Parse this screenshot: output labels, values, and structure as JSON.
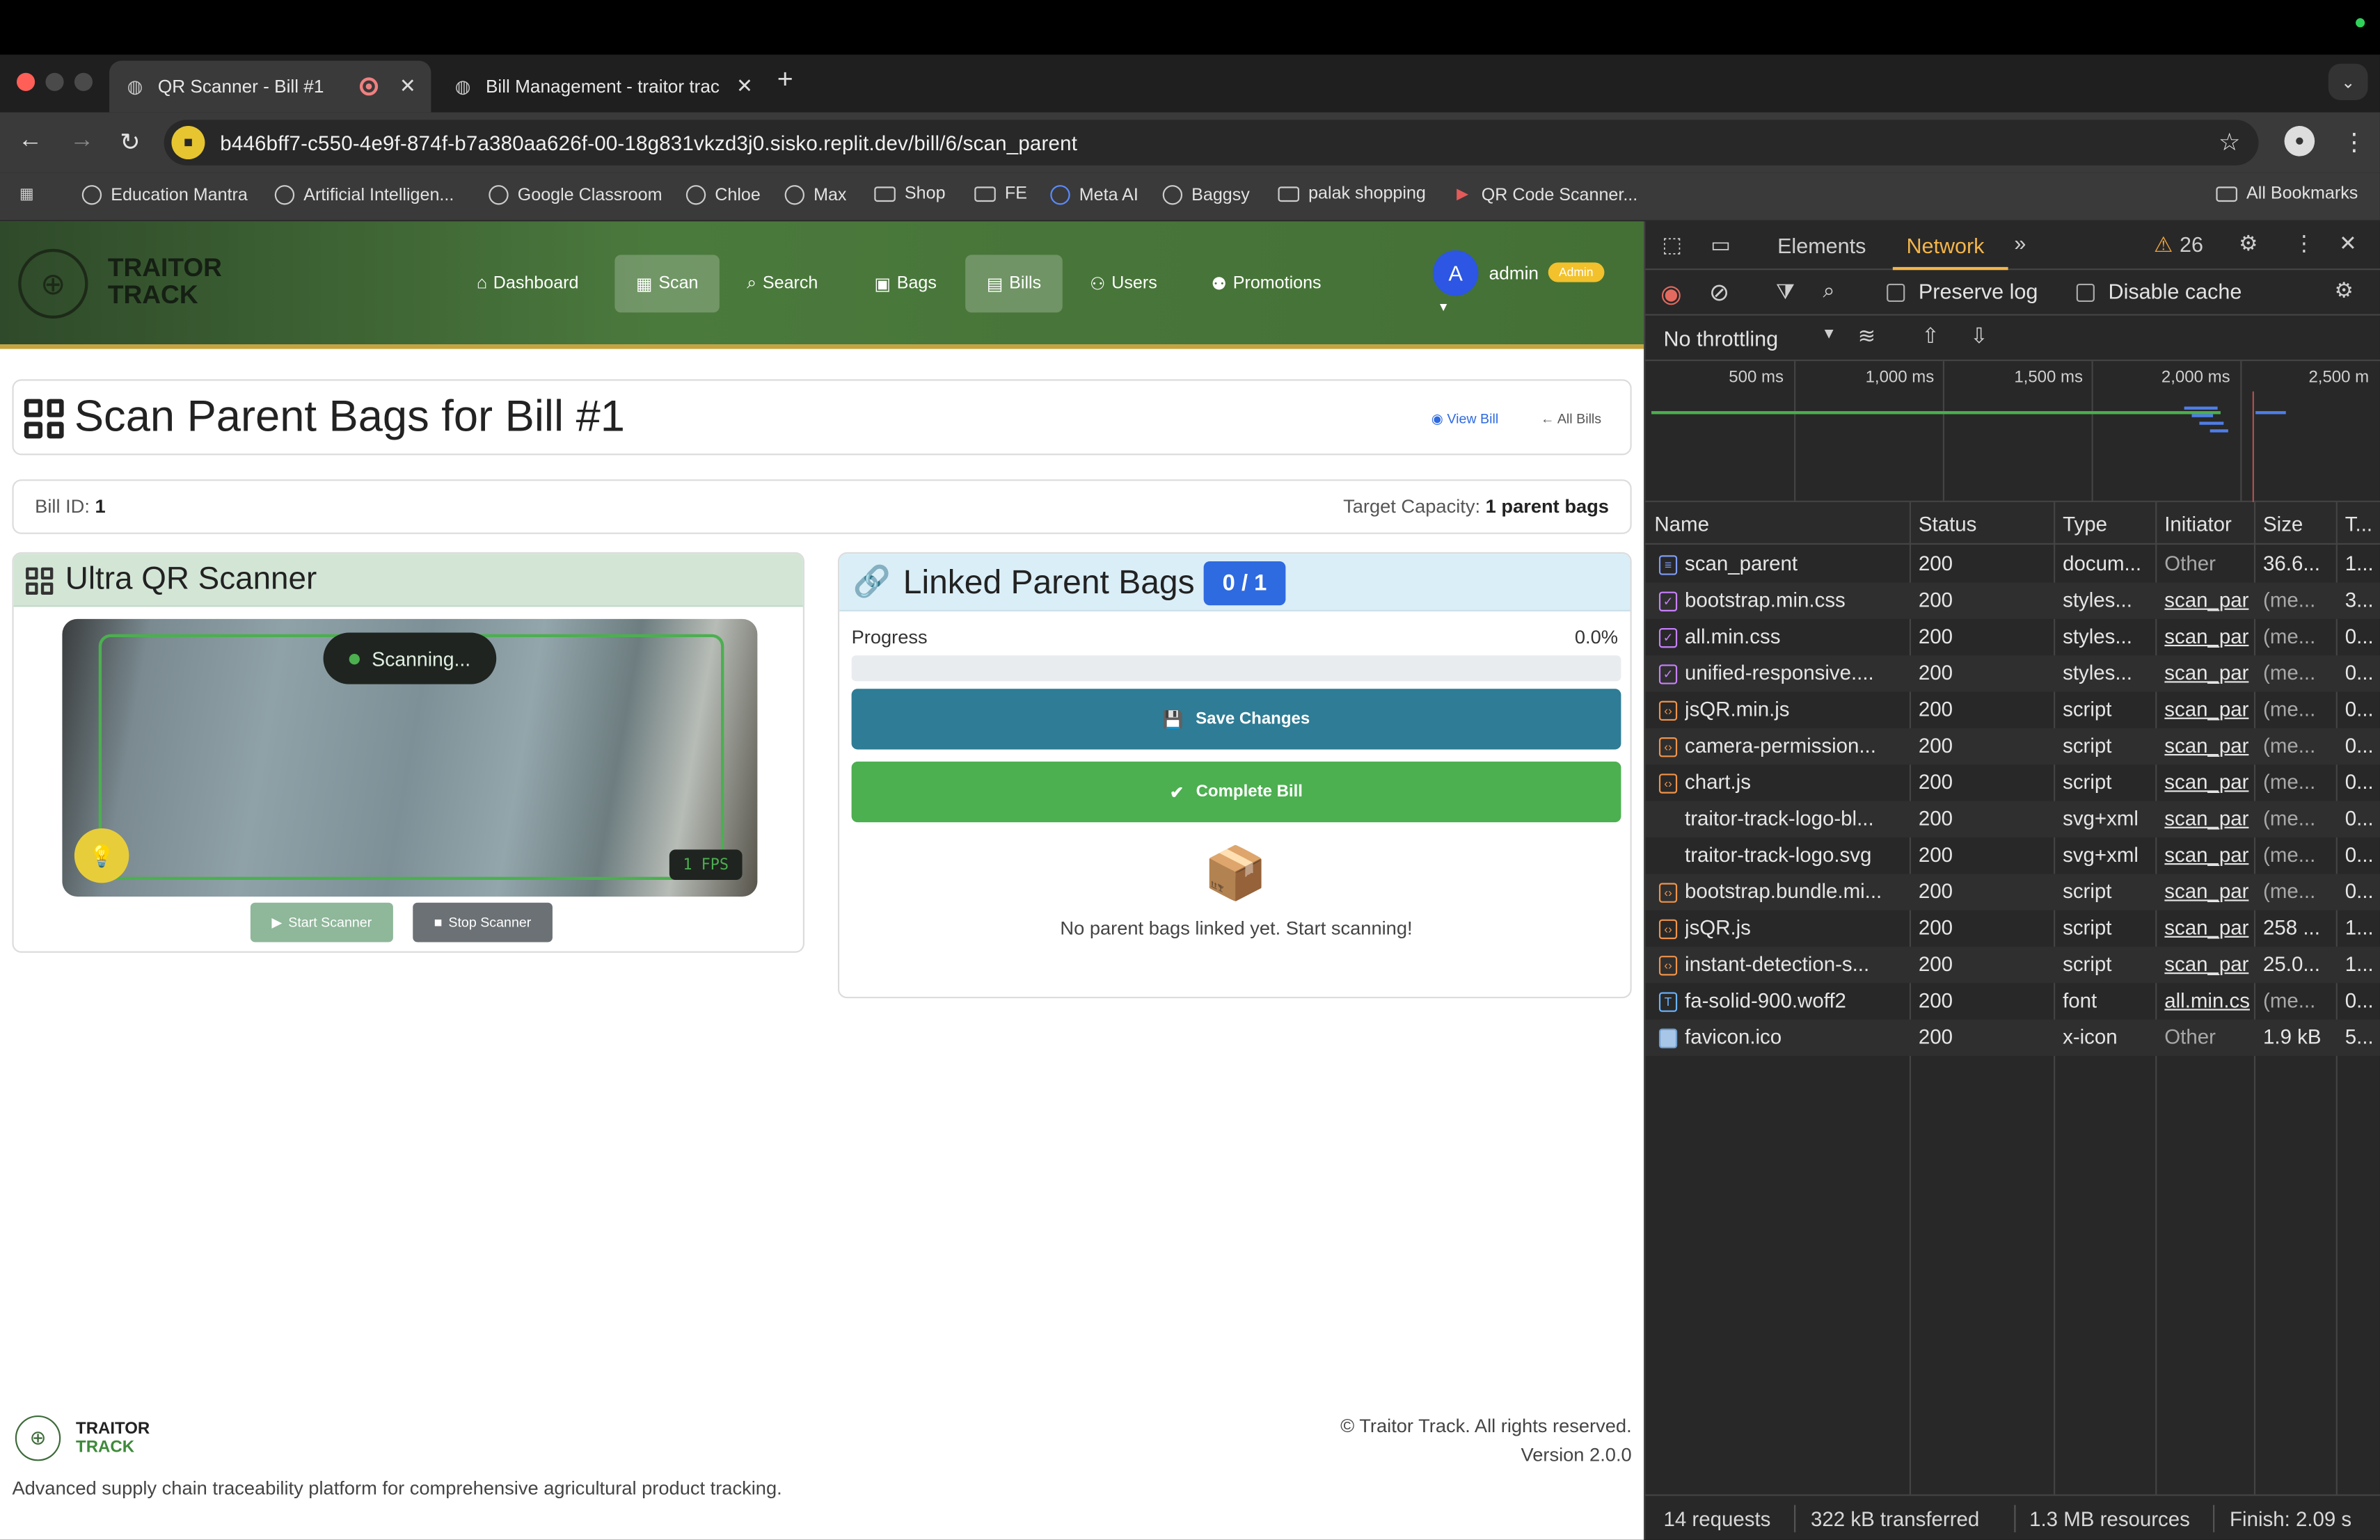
{
  "browser": {
    "tabs": [
      {
        "title": "QR Scanner - Bill #1"
      },
      {
        "title": "Bill Management - traitor trac"
      }
    ],
    "url": "b446bff7-c550-4e9f-874f-b7a380aa626f-00-18g831vkzd3j0.sisko.replit.dev/bill/6/scan_parent",
    "bookmarks": [
      "Education Mantra",
      "Artificial Intelligen...",
      "Google Classroom",
      "Chloe",
      "Max",
      "Shop",
      "FE",
      "Meta AI",
      "Baggsy",
      "palak shopping",
      "QR Code Scanner..."
    ],
    "all_bookmarks": "All Bookmarks"
  },
  "site": {
    "logo_line1": "TRAITOR",
    "logo_line2": "TRACK",
    "nav": [
      "Dashboard",
      "Scan",
      "Search",
      "Bags",
      "Bills",
      "Users",
      "Promotions"
    ],
    "user_initial": "A",
    "user_name": "admin",
    "user_badge": "Admin"
  },
  "page": {
    "title": "Scan Parent Bags for Bill #1",
    "view_bill": "View Bill",
    "all_bills": "All Bills",
    "bill_id_label": "Bill ID:",
    "bill_id": "1",
    "target_label": "Target Capacity:",
    "target_value": "1 parent bags"
  },
  "scanner": {
    "title": "Ultra QR Scanner",
    "status": "Scanning...",
    "fps": "1 FPS",
    "start_label": "Start Scanner",
    "stop_label": "Stop Scanner"
  },
  "linked": {
    "title": "Linked Parent Bags",
    "count": "0 / 1",
    "progress_label": "Progress",
    "progress_value": "0.0%",
    "progress_fraction": 0.0,
    "save_label": "Save Changes",
    "complete_label": "Complete Bill",
    "empty_text": "No parent bags linked yet. Start scanning!"
  },
  "footer": {
    "title1": "TRAITOR",
    "title2": "TRACK",
    "description": "Advanced supply chain traceability platform for comprehensive agricultural product tracking.",
    "copyright": "© Traitor Track. All rights reserved.",
    "version": "Version 2.0.0"
  },
  "devtools": {
    "tabs": [
      "Elements",
      "Network"
    ],
    "warnings": "26",
    "preserve_log": "Preserve log",
    "disable_cache": "Disable cache",
    "throttling": "No throttling",
    "timeline_ticks": [
      "500 ms",
      "1,000 ms",
      "1,500 ms",
      "2,000 ms",
      "2,500 m"
    ],
    "columns": [
      "Name",
      "Status",
      "Type",
      "Initiator",
      "Size",
      "T..."
    ],
    "requests": [
      {
        "name": "scan_parent",
        "status": "200",
        "type": "docum...",
        "initiator": "Other",
        "size": "36.6...",
        "time": "1...",
        "icon": "doc"
      },
      {
        "name": "bootstrap.min.css",
        "status": "200",
        "type": "styles...",
        "initiator": "scan_par",
        "size": "(me...",
        "time": "3...",
        "icon": "css"
      },
      {
        "name": "all.min.css",
        "status": "200",
        "type": "styles...",
        "initiator": "scan_par",
        "size": "(me...",
        "time": "0...",
        "icon": "css"
      },
      {
        "name": "unified-responsive....",
        "status": "200",
        "type": "styles...",
        "initiator": "scan_par",
        "size": "(me...",
        "time": "0...",
        "icon": "css"
      },
      {
        "name": "jsQR.min.js",
        "status": "200",
        "type": "script",
        "initiator": "scan_par",
        "size": "(me...",
        "time": "0...",
        "icon": "js"
      },
      {
        "name": "camera-permission...",
        "status": "200",
        "type": "script",
        "initiator": "scan_par",
        "size": "(me...",
        "time": "0...",
        "icon": "js"
      },
      {
        "name": "chart.js",
        "status": "200",
        "type": "script",
        "initiator": "scan_par",
        "size": "(me...",
        "time": "0...",
        "icon": "js"
      },
      {
        "name": "traitor-track-logo-bl...",
        "status": "200",
        "type": "svg+xml",
        "initiator": "scan_par",
        "size": "(me...",
        "time": "0...",
        "icon": "none"
      },
      {
        "name": "traitor-track-logo.svg",
        "status": "200",
        "type": "svg+xml",
        "initiator": "scan_par",
        "size": "(me...",
        "time": "0...",
        "icon": "none"
      },
      {
        "name": "bootstrap.bundle.mi...",
        "status": "200",
        "type": "script",
        "initiator": "scan_par",
        "size": "(me...",
        "time": "0...",
        "icon": "js"
      },
      {
        "name": "jsQR.js",
        "status": "200",
        "type": "script",
        "initiator": "scan_par",
        "size": "258 ...",
        "time": "1...",
        "icon": "js"
      },
      {
        "name": "instant-detection-s...",
        "status": "200",
        "type": "script",
        "initiator": "scan_par",
        "size": "25.0...",
        "time": "1...",
        "icon": "js"
      },
      {
        "name": "fa-solid-900.woff2",
        "status": "200",
        "type": "font",
        "initiator": "all.min.cs",
        "size": "(me...",
        "time": "0...",
        "icon": "font"
      },
      {
        "name": "favicon.ico",
        "status": "200",
        "type": "x-icon",
        "initiator": "Other",
        "size": "1.9 kB",
        "time": "5...",
        "icon": "img"
      }
    ],
    "summary": [
      "14 requests",
      "322 kB transferred",
      "1.3 MB resources",
      "Finish: 2.09 s"
    ]
  }
}
